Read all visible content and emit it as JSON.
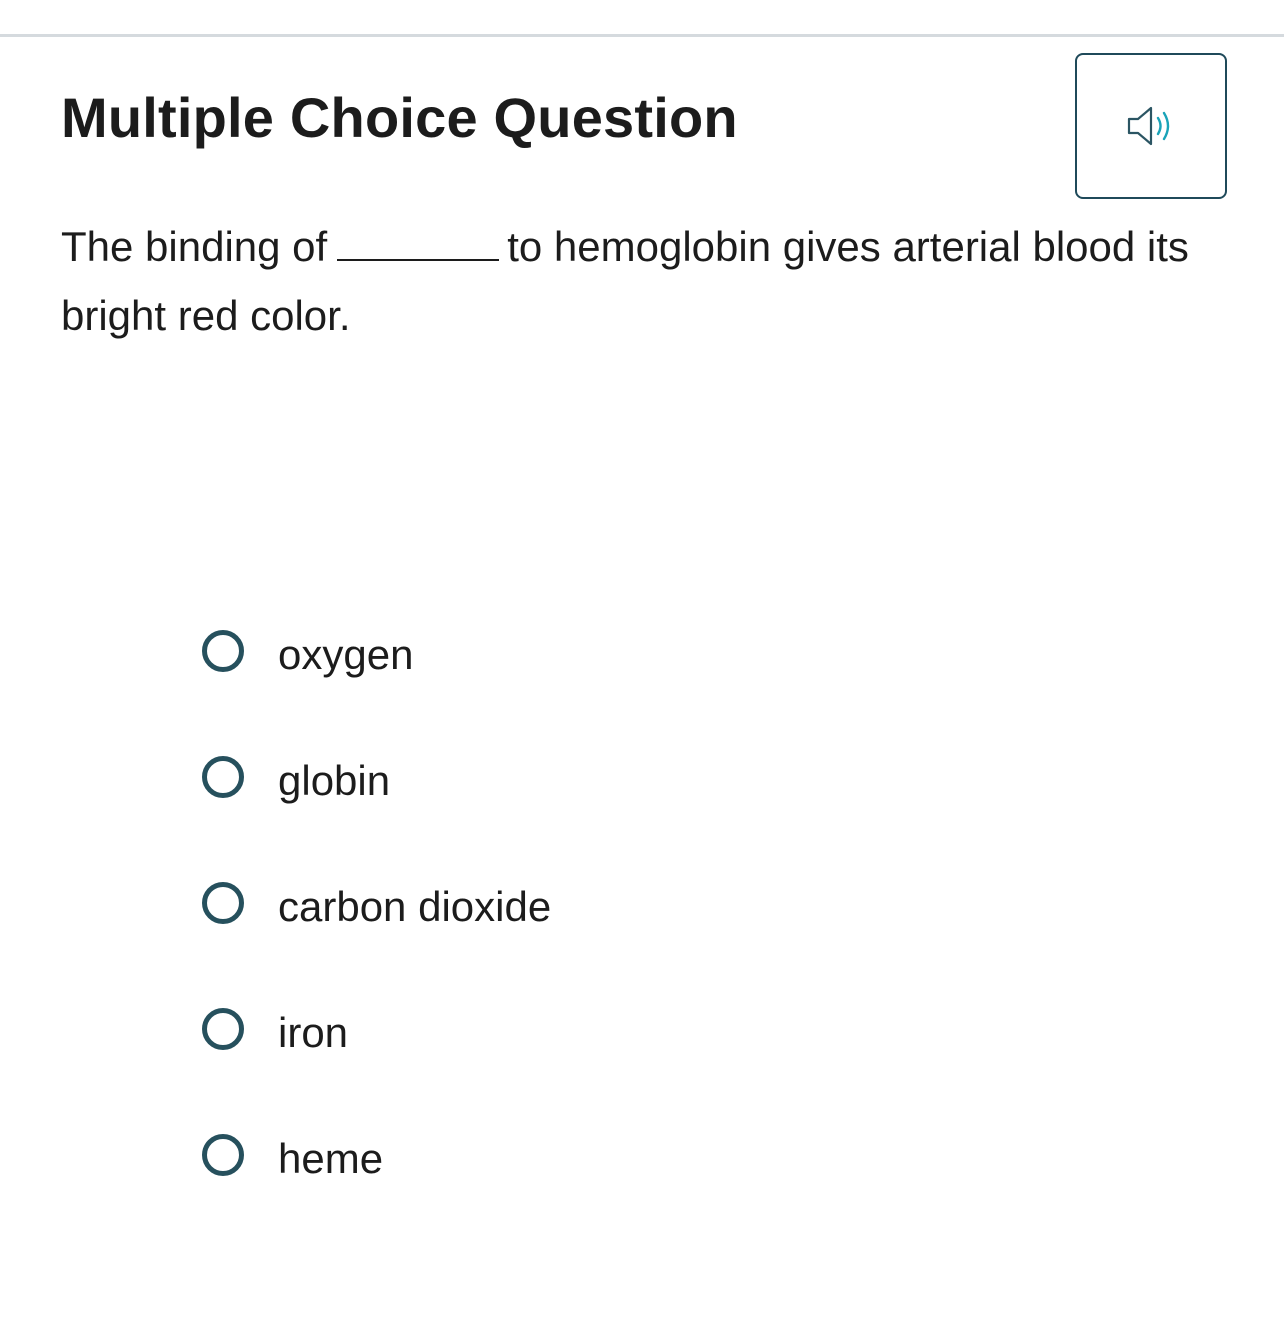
{
  "header": {
    "title": "Multiple Choice Question",
    "audio_icon": "speaker-icon"
  },
  "question": {
    "text_before": "The binding of",
    "text_after": "to hemoglobin gives arterial blood its bright red color."
  },
  "choices": [
    {
      "label": "oxygen"
    },
    {
      "label": "globin"
    },
    {
      "label": "carbon dioxide"
    },
    {
      "label": "iron"
    },
    {
      "label": "heme"
    }
  ],
  "colors": {
    "accent": "#26505d",
    "audio_wave": "#1aa3b8",
    "divider": "#d5dade",
    "text": "#1c1c1c"
  }
}
